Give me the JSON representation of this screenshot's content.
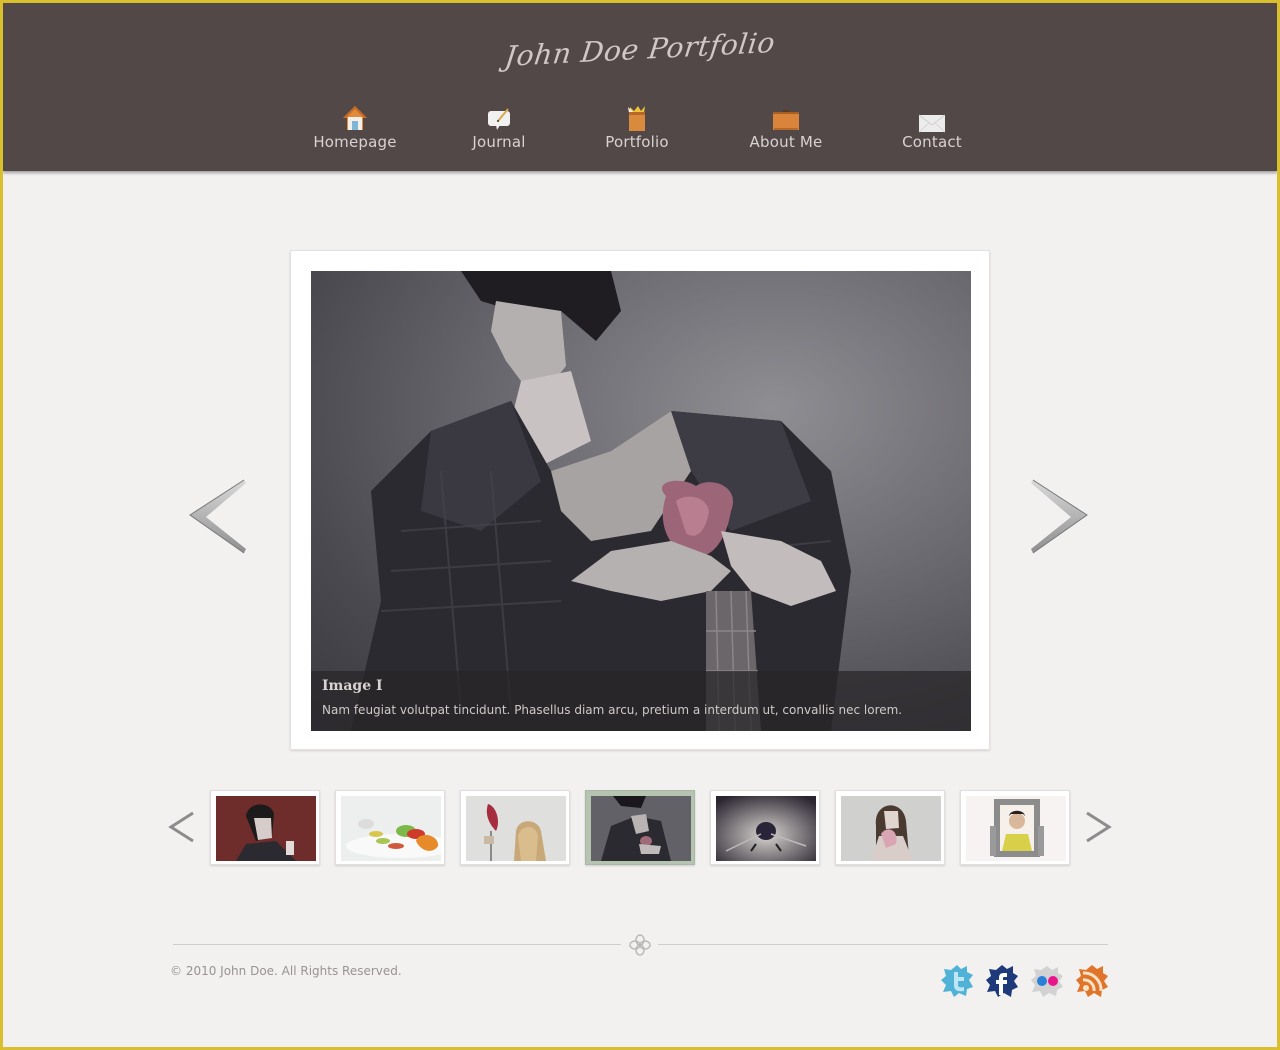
{
  "header": {
    "title": "John Doe Portfolio",
    "background": "#524847"
  },
  "nav": {
    "items": [
      {
        "label": "Homepage",
        "icon": "house-icon"
      },
      {
        "label": "Journal",
        "icon": "speech-bubble-pen-icon"
      },
      {
        "label": "Portfolio",
        "icon": "box-icon"
      },
      {
        "label": "About Me",
        "icon": "folder-icon"
      },
      {
        "label": "Contact",
        "icon": "envelope-icon"
      }
    ]
  },
  "slider": {
    "current_index": 4,
    "caption_title": "Image I",
    "caption_text": "Nam feugiat volutpat tincidunt. Phasellus diam arcu, pretium a interdum ut, convallis nec lorem.",
    "prev_icon": "chevron-left-icon",
    "next_icon": "chevron-right-icon"
  },
  "thumbnails": [
    {
      "subject": "man against red wall",
      "active": false
    },
    {
      "subject": "colorful fruit plate",
      "active": false
    },
    {
      "subject": "woman with flowers",
      "active": false
    },
    {
      "subject": "man holding heart",
      "active": true
    },
    {
      "subject": "insect close-up",
      "active": false
    },
    {
      "subject": "woman holding heart",
      "active": false
    },
    {
      "subject": "man in picture frame",
      "active": false
    }
  ],
  "footer": {
    "copyright": "© 2010 John Doe. All Rights Reserved.",
    "social": [
      {
        "name": "twitter",
        "color": "#4fb2d6"
      },
      {
        "name": "facebook",
        "color": "#1f3a7a"
      },
      {
        "name": "flickr",
        "color": "#c9c9c9"
      },
      {
        "name": "rss",
        "color": "#e0742a"
      }
    ]
  },
  "colors": {
    "accent_active_thumb": "#b5c4b1",
    "page_background": "#f3f0f0",
    "outer_border": "#d9bf2e"
  }
}
